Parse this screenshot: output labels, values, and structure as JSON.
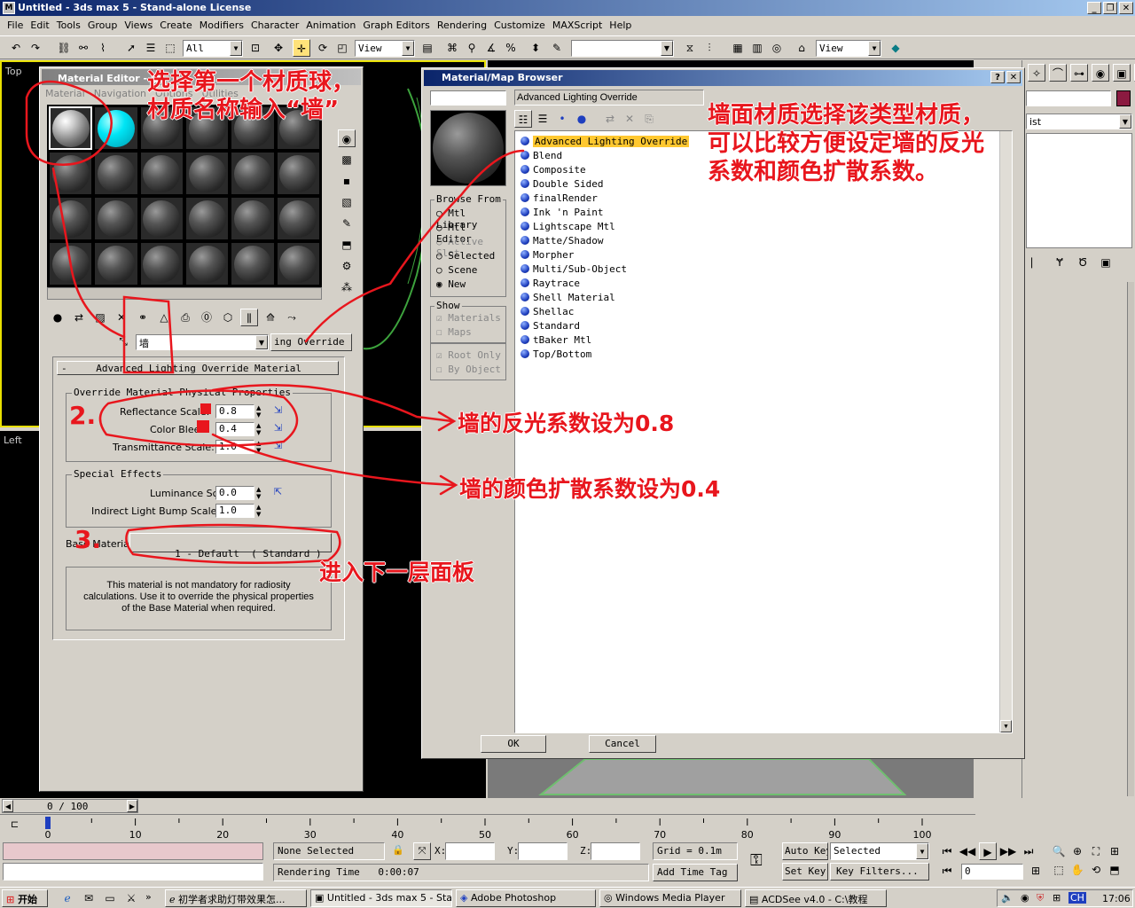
{
  "app": {
    "title": "Untitled - 3ds max 5 - Stand-alone License",
    "menus": [
      "File",
      "Edit",
      "Tools",
      "Group",
      "Views",
      "Create",
      "Modifiers",
      "Character",
      "Animation",
      "Graph Editors",
      "Rendering",
      "Customize",
      "MAXScript",
      "Help"
    ],
    "toolbar": {
      "selection_filter": "All",
      "ref_coord": "View",
      "ref_coord2": "View"
    }
  },
  "viewports": {
    "top_label": "Top",
    "left_label": "Left"
  },
  "material_editor": {
    "title": "Material Editor - 墙",
    "menus": [
      "Material",
      "Navigation",
      "Options",
      "Utilities"
    ],
    "material_name": "墙",
    "material_type": "ing Override",
    "rollout_title": "Advanced Lighting Override Material",
    "override_group": "Override Material Physical Properties",
    "reflectance_label": "Reflectance Scale:",
    "reflectance_value": "0.8",
    "color_bleed_label": "Color Bleed:",
    "color_bleed_value": "0.4",
    "transmittance_label": "Transmittance Scale:",
    "transmittance_value": "1.0",
    "special_group": "Special Effects",
    "luminance_label": "Luminance Scale:",
    "luminance_value": "0.0",
    "bump_label": "Indirect Light Bump Scale:",
    "bump_value": "1.0",
    "base_label": "Base Material:",
    "base_value": "1 - Default  ( Standard )",
    "note": "This material is not mandatory for radiosity calculations. Use it to override the physical properties of the Base Material when required."
  },
  "browser": {
    "title": "Material/Map Browser",
    "name_field": "Advanced Lighting Override",
    "browse_from": "Browse From",
    "browse_options": [
      "Mtl Library",
      "Mtl Editor",
      "Active Slot",
      "Selected",
      "Scene",
      "New"
    ],
    "show_label": "Show",
    "show_options": [
      "Materials",
      "Maps"
    ],
    "extra_options": [
      "Root Only",
      "By Object"
    ],
    "items": [
      "Advanced Lighting Override",
      "Blend",
      "Composite",
      "Double Sided",
      "finalRender",
      "Ink 'n Paint",
      "Lightscape Mtl",
      "Matte/Shadow",
      "Morpher",
      "Multi/Sub-Object",
      "Raytrace",
      "Shell Material",
      "Shellac",
      "Standard",
      "tBaker Mtl",
      "Top/Bottom"
    ],
    "ok": "OK",
    "cancel": "Cancel"
  },
  "command_panel": {
    "list_label": "ist"
  },
  "timeline": {
    "frame": "0 / 100",
    "ticks": [
      "0",
      "10",
      "20",
      "30",
      "40",
      "50",
      "60",
      "70",
      "80",
      "90",
      "100"
    ]
  },
  "status": {
    "selection": "None Selected",
    "x_label": "X:",
    "y_label": "Y:",
    "z_label": "Z:",
    "grid": "Grid = 0.1m",
    "auto_key": "Auto Key",
    "set_key": "Set Key",
    "key_mode": "Selected",
    "key_filters": "Key Filters...",
    "render_label": "Rendering Time",
    "render_time": "0:00:07",
    "add_time_tag": "Add Time Tag",
    "frame_field": "0"
  },
  "taskbar": {
    "start": "开始",
    "tasks": [
      "初学者求助灯带效果怎...",
      "Untitled - 3ds max 5 - Sta...",
      "Adobe Photoshop",
      "Windows Media Player",
      "ACDSee v4.0 - C:\\教程"
    ],
    "tray_lang": "CH",
    "clock": "17:06"
  },
  "annotations": {
    "a1_line1": "选择第一个材质球，",
    "a1_line2": "材质名称输入“墙”",
    "a2_line1": "墙面材质选择该类型材质，",
    "a2_line2": "可以比较方便设定墙的反光",
    "a2_line3": "系数和颜色扩散系数。",
    "a3": "墙的反光系数设为0.8",
    "a4": "墙的颜色扩散系数设为0.4",
    "a5": "进入下一层面板",
    "n2": "2.",
    "n3": "3."
  },
  "colors": {
    "annotation": "#e8161d",
    "title_blue": "#0a246a",
    "highlight": "#ffc830",
    "cyan_ball": "#00e5f5"
  }
}
